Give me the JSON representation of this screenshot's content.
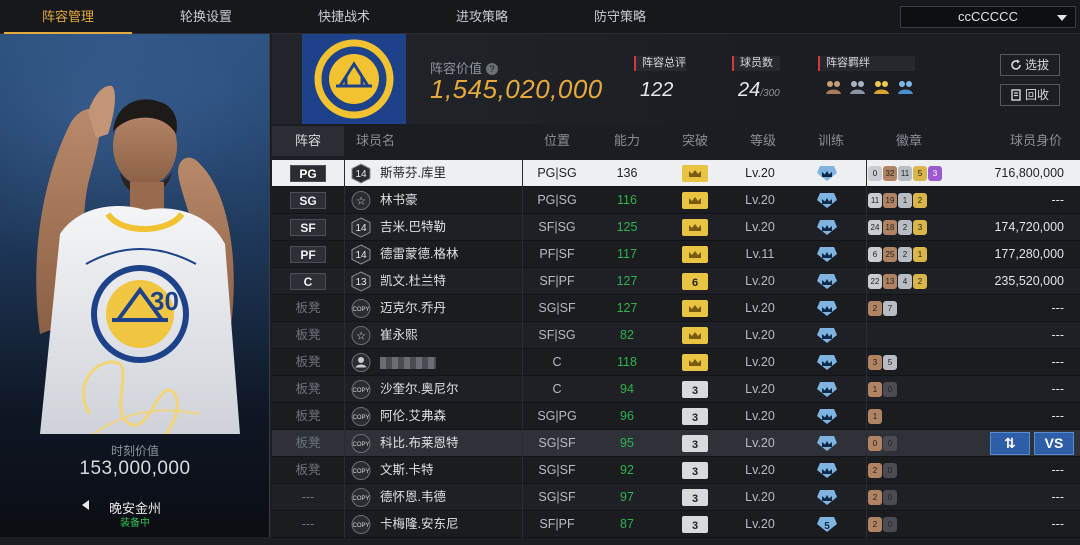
{
  "tabs": [
    {
      "label": "阵容管理",
      "active": true
    },
    {
      "label": "轮换设置"
    },
    {
      "label": "快捷战术"
    },
    {
      "label": "进攻策略"
    },
    {
      "label": "防守策略"
    }
  ],
  "team_select": {
    "value": "ccCCCCC"
  },
  "player_card": {
    "moment_label": "时刻价值",
    "moment_value": "153,000,000",
    "card_name": "晚安金州",
    "status": "装备中"
  },
  "lineup_header": {
    "value_label": "阵容价值",
    "value": "1,545,020,000",
    "rating_label": "阵容总评",
    "rating": "122",
    "count_label": "球员数",
    "count": "24",
    "count_max": "/300",
    "chem_label": "阵容羁绊",
    "chem_icons": [
      "chem-icon-1",
      "chem-icon-2",
      "chem-icon-3",
      "chem-icon-4"
    ],
    "pick_label": "选拔",
    "recycle_label": "回收"
  },
  "columns": {
    "roster": "阵容",
    "name": "球员名",
    "position": "位置",
    "ability": "能力",
    "breakthrough": "突破",
    "level": "等级",
    "training": "训练",
    "badges": "徽章",
    "value": "球员身价"
  },
  "colors": {
    "accent": "#e5a93d",
    "ability_green": "#2fb34d",
    "button_blue": "#2e5ea8"
  },
  "rows": [
    {
      "slot": "PG",
      "number": "14",
      "name": "斯蒂芬.库里",
      "pos": "PG|SG",
      "ability": "136",
      "break": "crown",
      "level": "Lv.20",
      "train": "",
      "badges": [
        "0",
        "32",
        "11",
        "5",
        "3"
      ],
      "value": "716,800,000",
      "selected": true
    },
    {
      "slot": "SG",
      "number": "☆",
      "name": "林书豪",
      "pos": "PG|SG",
      "ability": "116",
      "break": "crown",
      "level": "Lv.20",
      "train": "",
      "badges": [
        "11",
        "19",
        "1",
        "2"
      ],
      "value": "---"
    },
    {
      "slot": "SF",
      "number": "14",
      "name": "吉米.巴特勒",
      "pos": "SF|SG",
      "ability": "125",
      "break": "crown",
      "level": "Lv.20",
      "train": "",
      "badges": [
        "24",
        "18",
        "2",
        "3"
      ],
      "value": "174,720,000"
    },
    {
      "slot": "PF",
      "number": "14",
      "name": "德雷蒙德.格林",
      "pos": "PF|SF",
      "ability": "117",
      "break": "crown",
      "level": "Lv.11",
      "train": "",
      "badges": [
        "6",
        "25",
        "2",
        "1"
      ],
      "value": "177,280,000"
    },
    {
      "slot": "C",
      "number": "13",
      "name": "凯文.杜兰特",
      "pos": "SF|PF",
      "ability": "127",
      "break": "6",
      "level": "Lv.20",
      "train": "",
      "badges": [
        "22",
        "13",
        "4",
        "2"
      ],
      "value": "235,520,000"
    },
    {
      "slot": "板凳",
      "number": "COPY",
      "name": "迈克尔.乔丹",
      "pos": "SG|SF",
      "ability": "127",
      "break": "crown",
      "level": "Lv.20",
      "train": "",
      "badges": [
        "2",
        "7"
      ],
      "value": "---"
    },
    {
      "slot": "板凳",
      "number": "☆",
      "name": "崔永熙",
      "pos": "SF|SG",
      "ability": "82",
      "break": "crown",
      "level": "Lv.20",
      "train": "",
      "badges": [],
      "value": "---"
    },
    {
      "slot": "板凳",
      "number": "avatar",
      "name": "",
      "pos": "C",
      "ability": "118",
      "break": "crown",
      "level": "Lv.20",
      "train": "",
      "badges": [
        "3",
        "5"
      ],
      "value": "---"
    },
    {
      "slot": "板凳",
      "number": "COPY",
      "name": "沙奎尔.奥尼尔",
      "pos": "C",
      "ability": "94",
      "break": "3",
      "level": "Lv.20",
      "train": "",
      "badges": [
        "1",
        "0"
      ],
      "value": "---"
    },
    {
      "slot": "板凳",
      "number": "COPY",
      "name": "阿伦.艾弗森",
      "pos": "SG|PG",
      "ability": "96",
      "break": "3",
      "level": "Lv.20",
      "train": "",
      "badges": [
        "1"
      ],
      "value": "---"
    },
    {
      "slot": "板凳",
      "number": "COPY",
      "name": "科比.布莱恩特",
      "pos": "SG|SF",
      "ability": "95",
      "break": "3",
      "level": "Lv.20",
      "train": "",
      "badges": [
        "0",
        "0"
      ],
      "value": "",
      "highlight": true
    },
    {
      "slot": "板凳",
      "number": "COPY",
      "name": "文斯.卡特",
      "pos": "SG|SF",
      "ability": "92",
      "break": "3",
      "level": "Lv.20",
      "train": "",
      "badges": [
        "2",
        "0"
      ],
      "value": "---"
    },
    {
      "slot": "---",
      "number": "COPY",
      "name": "德怀恩.韦德",
      "pos": "SG|SF",
      "ability": "97",
      "break": "3",
      "level": "Lv.20",
      "train": "",
      "badges": [
        "2",
        "0"
      ],
      "value": "---"
    },
    {
      "slot": "---",
      "number": "COPY",
      "name": "卡梅隆.安东尼",
      "pos": "SF|PF",
      "ability": "87",
      "break": "3",
      "level": "Lv.20",
      "train": "5",
      "badges": [
        "2",
        "0"
      ],
      "value": "---"
    }
  ],
  "row_actions": {
    "swap": "⇅",
    "vs": "VS"
  }
}
